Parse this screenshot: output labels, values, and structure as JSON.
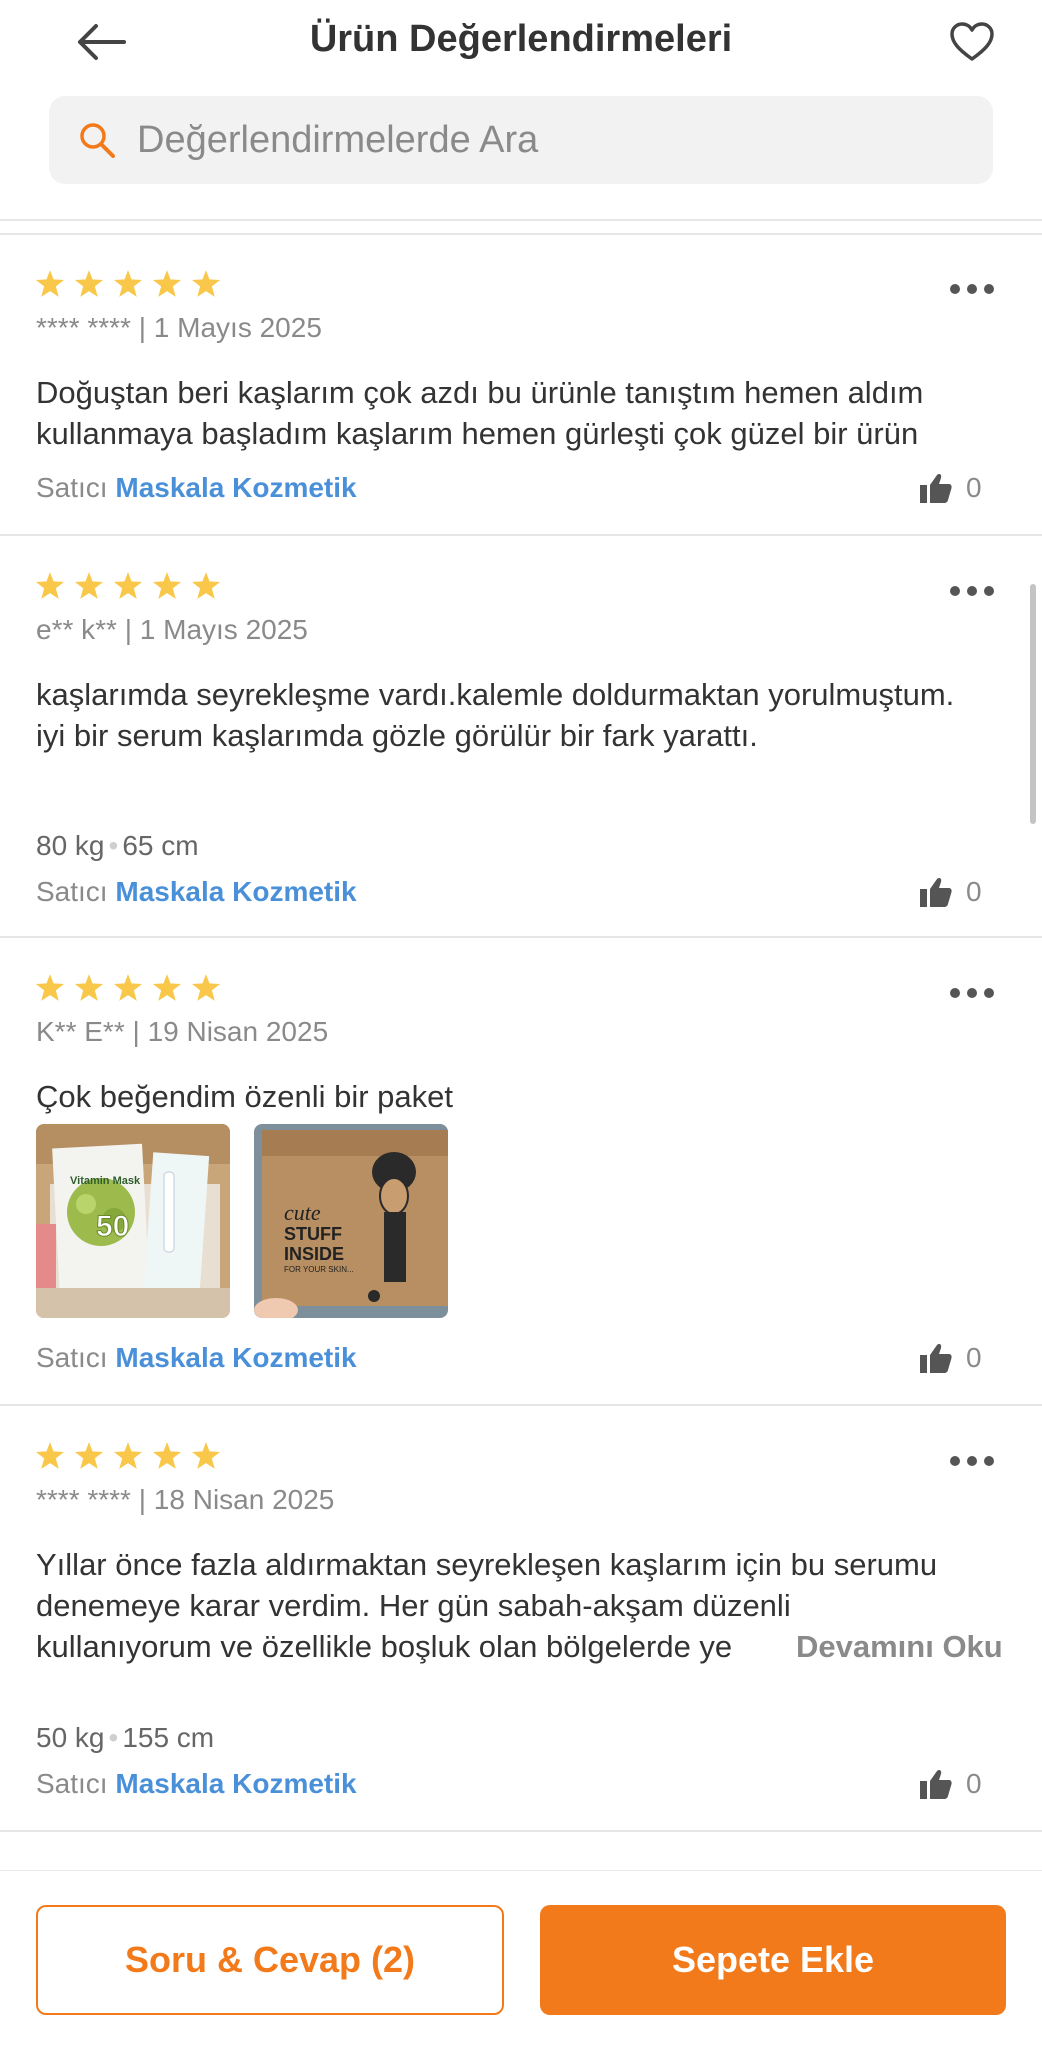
{
  "header": {
    "title": "Ürün Değerlendirmeleri",
    "back_icon": "arrow-left-icon",
    "favorite_icon": "heart-outline-icon"
  },
  "search": {
    "placeholder": "Değerlendirmelerde Ara",
    "value": ""
  },
  "colors": {
    "accent": "#f27a1a",
    "star": "#f9c84a",
    "seller_link": "#4a90d9",
    "muted_text": "#8a8a8a"
  },
  "reviews": [
    {
      "rating": 5,
      "author": "**** ****",
      "date": "1 Mayıs 2025",
      "text": "Doğuştan beri kaşlarım çok azdı bu ürünle tanıştım hemen aldım kullanmaya başladım kaşlarım hemen gürleşti çok güzel bir ürün",
      "seller_prefix": "Satıcı",
      "seller": "Maskala Kozmetik",
      "likes": "0"
    },
    {
      "rating": 5,
      "author": "e** k**",
      "date": "1 Mayıs 2025",
      "text": "kaşlarımda seyrekleşme vardı.kalemle doldurmaktan yorulmuştum.  iyi bir serum kaşlarımda gözle görülür bir fark yarattı.",
      "weight": "80 kg",
      "height": "65 cm",
      "seller_prefix": "Satıcı",
      "seller": "Maskala Kozmetik",
      "likes": "0"
    },
    {
      "rating": 5,
      "author": "K** E**",
      "date": "19 Nisan 2025",
      "text": "Çok beğendim özenli bir paket",
      "photos": [
        {
          "name": "box-contents-photo",
          "labels": [
            "Vitamin Mask",
            "50"
          ]
        },
        {
          "name": "kraft-box-photo",
          "labels": [
            "cute",
            "STUFF",
            "INSIDE",
            "FOR YOUR SKIN..."
          ]
        }
      ],
      "seller_prefix": "Satıcı",
      "seller": "Maskala Kozmetik",
      "likes": "0"
    },
    {
      "rating": 5,
      "author": "**** ****",
      "date": "18 Nisan 2025",
      "text_lines": [
        "Yıllar önce fazla aldırmaktan seyrekleşen kaşlarım için bu serumu",
        "denemeye karar verdim. Her gün sabah-akşam düzenli",
        "kullanıyorum ve özellikle boşluk olan bölgelerde ye"
      ],
      "read_more": "Devamını Oku",
      "weight": "50 kg",
      "height": "155 cm",
      "seller_prefix": "Satıcı",
      "seller": "Maskala Kozmetik",
      "likes": "0"
    }
  ],
  "bottom_bar": {
    "qa_label": "Soru & Cevap (2)",
    "cart_label": "Sepete Ekle"
  }
}
